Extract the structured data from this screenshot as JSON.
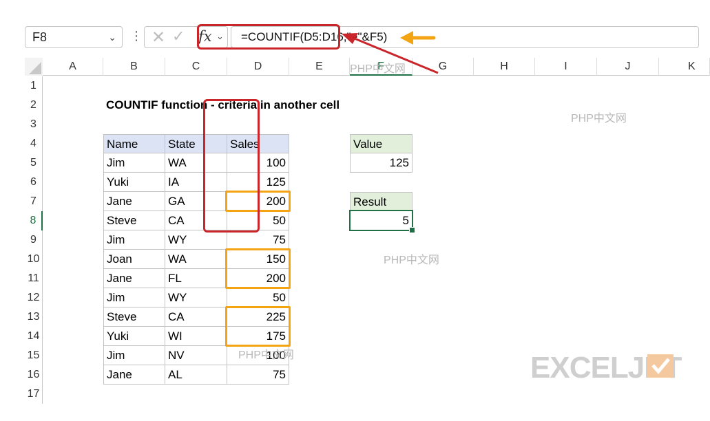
{
  "formula_bar": {
    "name_box": "F8",
    "formula": "=COUNTIF(D5:D16,\">\"&F5)",
    "fx_label": "fx"
  },
  "columns": [
    "A",
    "B",
    "C",
    "D",
    "E",
    "F",
    "G",
    "H",
    "I",
    "J",
    "K"
  ],
  "rows": [
    "1",
    "2",
    "3",
    "4",
    "5",
    "6",
    "7",
    "8",
    "9",
    "10",
    "11",
    "12",
    "13",
    "14",
    "15",
    "16",
    "17"
  ],
  "sheet": {
    "title": "COUNTIF function - criteria in another cell",
    "table_headers": [
      "Name",
      "State",
      "Sales"
    ],
    "table_rows": [
      [
        "Jim",
        "WA",
        "100"
      ],
      [
        "Yuki",
        "IA",
        "125"
      ],
      [
        "Jane",
        "GA",
        "200"
      ],
      [
        "Steve",
        "CA",
        "50"
      ],
      [
        "Jim",
        "WY",
        "75"
      ],
      [
        "Joan",
        "WA",
        "150"
      ],
      [
        "Jane",
        "FL",
        "200"
      ],
      [
        "Jim",
        "WY",
        "50"
      ],
      [
        "Steve",
        "CA",
        "225"
      ],
      [
        "Yuki",
        "WI",
        "175"
      ],
      [
        "Jim",
        "NV",
        "100"
      ],
      [
        "Jane",
        "AL",
        "75"
      ]
    ],
    "value_label": "Value",
    "value": "125",
    "result_label": "Result",
    "result": "5"
  },
  "watermarks": [
    "PHP中文网",
    "PHP中文网",
    "PHP中文网",
    "PHP中文网"
  ],
  "logo": "EXCELJET",
  "colors": {
    "accent_green": "#1f7145",
    "highlight_orange": "#f2a413",
    "annotation_red": "#c9252b",
    "header_blue": "#dbe3f4",
    "header_green": "#e2efda"
  }
}
